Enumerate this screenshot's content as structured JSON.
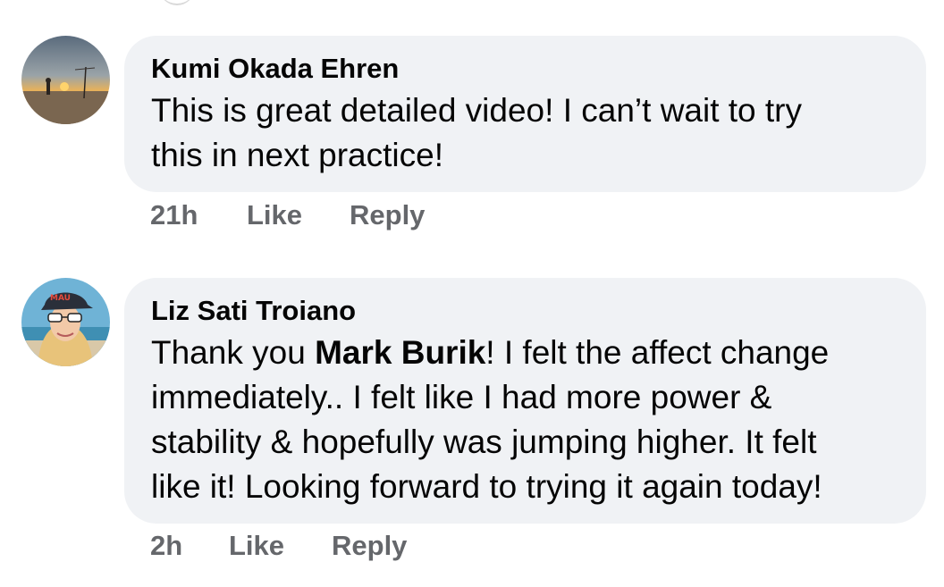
{
  "comments": [
    {
      "author": "Kumi Okada Ehren",
      "text_line1": "This is great detailed video! I can’t wait to try",
      "text_line2": "this in next practice!",
      "time": "21h",
      "like_label": "Like",
      "reply_label": "Reply"
    },
    {
      "author": "Liz Sati Troiano",
      "text_prefix": "Thank you ",
      "mention": "Mark Burik",
      "text_line1_rest": "! I felt the affect change",
      "text_line2": "immediately.. I felt like I had more power &",
      "text_line3": "stability & hopefully was jumping higher. It felt",
      "text_line4": "like it! Looking forward to trying it again today!",
      "time": "2h",
      "like_label": "Like",
      "reply_label": "Reply"
    }
  ],
  "colors": {
    "bubble_bg": "#f0f2f5",
    "text": "#050505",
    "meta": "#65676b"
  }
}
